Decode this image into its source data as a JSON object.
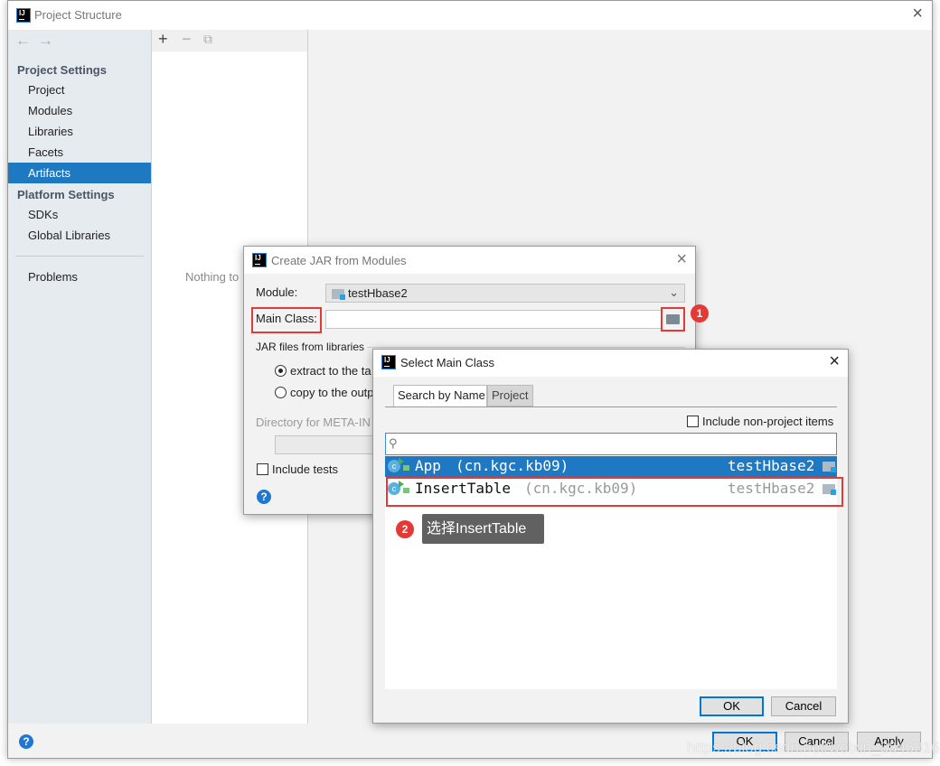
{
  "window": {
    "title": "Project Structure",
    "close": "×"
  },
  "sidebar": {
    "back": "←",
    "forward": "→",
    "project_settings": "Project Settings",
    "items": [
      {
        "label": "Project"
      },
      {
        "label": "Modules"
      },
      {
        "label": "Libraries"
      },
      {
        "label": "Facets"
      },
      {
        "label": "Artifacts",
        "selected": true
      }
    ],
    "platform_settings": "Platform Settings",
    "platform_items": [
      {
        "label": "SDKs"
      },
      {
        "label": "Global Libraries"
      }
    ],
    "problems": "Problems"
  },
  "middle": {
    "add": "+",
    "remove": "−",
    "copy": "⧉",
    "empty_text": "Nothing to"
  },
  "footer": {
    "ok": "OK",
    "cancel": "Cancel",
    "apply": "Apply",
    "help": "?",
    "watermark": "https://blog.csdn.net/weixin_38468167"
  },
  "jar_dialog": {
    "title": "Create JAR from Modules",
    "module_label": "Module:",
    "module_value": "testHbase2",
    "main_class_label": "Main Class:",
    "main_class_value": "",
    "jar_libs_label": "JAR files from libraries",
    "radio_extract": "extract to the ta",
    "radio_copy": "copy to the outp",
    "directory_label": "Directory for META-IN",
    "include_tests": "Include tests",
    "help": "?",
    "badge": "1"
  },
  "select_dialog": {
    "title": "Select Main Class",
    "tabs": [
      {
        "label": "Search by Name",
        "active": true
      },
      {
        "label": "Project"
      }
    ],
    "include_non_project": "Include non-project items",
    "search_value": "",
    "rows": [
      {
        "name": "App",
        "package": "(cn.kgc.kb09)",
        "module": "testHbase2",
        "selected": true
      },
      {
        "name": "InsertTable",
        "package": "(cn.kgc.kb09)",
        "module": "testHbase2",
        "selected": false
      }
    ],
    "ok": "OK",
    "cancel": "Cancel",
    "badge": "2",
    "tooltip": "选择InsertTable"
  },
  "colors": {
    "accent": "#1e78c2",
    "annotation_red": "#e53935"
  }
}
